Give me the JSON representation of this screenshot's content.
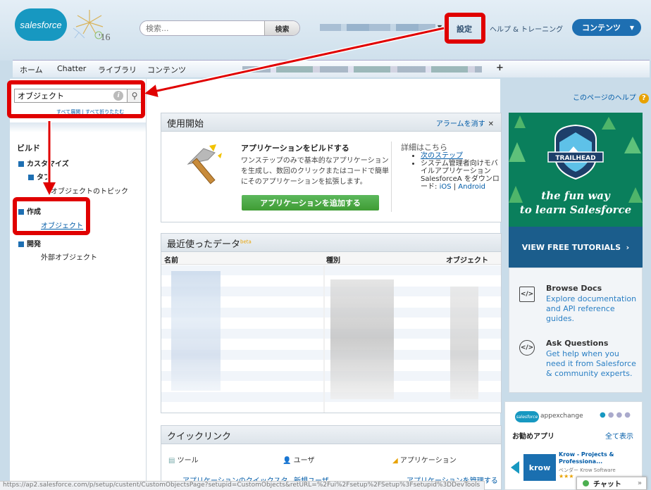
{
  "header": {
    "logo_text": "salesforce",
    "year_text": "'16",
    "search_placeholder": "検索...",
    "search_button": "検索",
    "setup_link": "設定",
    "help_link": "ヘルプ & トレーニング",
    "content_button": "コンテンツ"
  },
  "tabs": [
    "ホーム",
    "Chatter",
    "ライブラリ",
    "コンテンツ"
  ],
  "sidebar": {
    "quickfind_value": "オブジェクト",
    "expand_all": "すべて展開",
    "collapse_all": "すべて折りたたむ",
    "build_label": "ビルド",
    "customize_label": "カスタマイズ",
    "tab_label": "タブ",
    "object_topics": "オブジェクトのトピック",
    "create_label": "作成",
    "objects_link": "オブジェクト",
    "develop_label": "開発",
    "external_objects": "外部オブジェクト"
  },
  "page_help": "このページのヘルプ",
  "getting_started": {
    "title": "使用開始",
    "dismiss": "アラームを消す",
    "build_title": "アプリケーションをビルドする",
    "build_desc": "ワンステップのみで基本的なアプリケーションを生成し、数回のクリックまたはコードで簡単にそのアプリケーションを拡張します。",
    "add_button": "アプリケーションを追加する",
    "more_title": "詳細はこちら",
    "more_next": "次のステップ",
    "more_admin": "システム管理者向けモバイルアプリケーション SalesforceA をダウンロード:",
    "more_ios": "iOS",
    "more_android": "Android"
  },
  "recent": {
    "title": "最近使ったデータ",
    "beta": "beta",
    "col_name": "名前",
    "col_type": "種別",
    "col_object": "オブジェクト"
  },
  "quicklinks": {
    "title": "クイックリンク",
    "tools": "ツール",
    "users": "ユーザ",
    "apps": "アプリケーション",
    "link_quickstart": "アプリケーションのクイックスタ",
    "link_new_user": "新規ユーザ",
    "link_manage_apps": "アプリケーションを管理する"
  },
  "trailhead": {
    "badge": "TRAILHEAD",
    "tagline_1": "the fun way",
    "tagline_2": "to learn Salesforce",
    "button": "VIEW FREE TUTORIALS"
  },
  "resources": [
    {
      "title": "Browse Docs",
      "desc": "Explore documentation and API reference guides."
    },
    {
      "title": "Ask Questions",
      "desc": "Get help when you need it from Salesforce & community experts."
    }
  ],
  "appexchange": {
    "logo": "salesforce",
    "name": "appexchange",
    "title": "お勧めアプリ",
    "show_all": "全て表示",
    "app_logo": "krow",
    "app_title": "Krow - Projects & Professiona...",
    "app_vendor": "ベンダー Krow Software",
    "stars": "★★★"
  },
  "chat": {
    "label": "チャット",
    "close": "»"
  },
  "status_url": "https://ap2.salesforce.com/p/setup/custent/CustomObjectsPage?setupid=CustomObjects&retURL=%2Fui%2Fsetup%2FSetup%3Fsetupid%3DDevTools",
  "colors": {
    "accent": "#1e6fb2",
    "annotation": "#e00000",
    "trailhead": "#0a7f5c",
    "add_button": "#3f9c34"
  }
}
